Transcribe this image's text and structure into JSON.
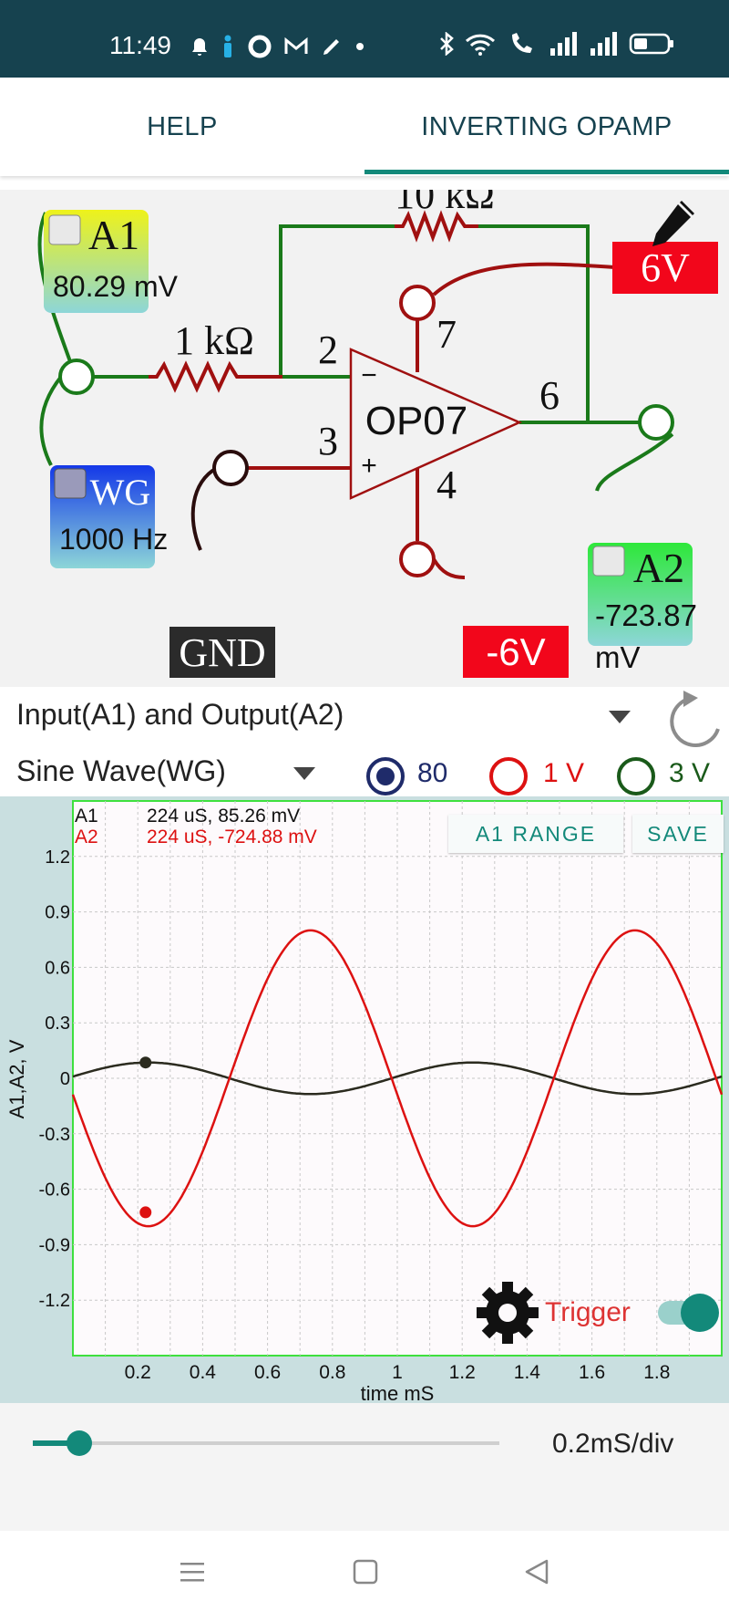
{
  "status": {
    "time": "11:49"
  },
  "tabs": [
    {
      "label": "HELP"
    },
    {
      "label": "INVERTING OPAMP"
    }
  ],
  "circuit": {
    "meter_a1": {
      "name": "A1",
      "value": "80.29 mV"
    },
    "meter_a2": {
      "name": "A2",
      "value_line1": "-723.87",
      "value_line2": "mV"
    },
    "wg": {
      "name": "WG",
      "value": "1000 Hz"
    },
    "feedback_resistor": "10 kΩ",
    "input_resistor": "1 kΩ",
    "opamp": "OP07",
    "pins": {
      "inv": "2",
      "noninv": "3",
      "out": "6",
      "vplus": "7",
      "vminus": "4"
    },
    "supply_pos": "6V",
    "supply_neg": "-6V",
    "gnd": "GND"
  },
  "controls": {
    "view_select": "Input(A1) and Output(A2)",
    "source_select": "Sine Wave(WG)",
    "ranges": [
      {
        "label": "80",
        "selected": true
      },
      {
        "label": "1 V",
        "selected": false
      },
      {
        "label": "3 V",
        "selected": false
      }
    ]
  },
  "plot": {
    "a1_label": "A1",
    "a1_readout": "224 uS, 85.26 mV",
    "a2_label": "A2",
    "a2_readout": "224 uS, -724.88 mV",
    "range_button": "A1 RANGE",
    "save_button": "SAVE",
    "trigger_label": "Trigger",
    "trigger_on": true,
    "ylabel": "A1,A2, V",
    "xlabel": "time mS",
    "y_ticks": [
      "1.2",
      "0.9",
      "0.6",
      "0.3",
      "0",
      "-0.3",
      "-0.6",
      "-0.9",
      "-1.2"
    ],
    "x_ticks": [
      "0.2",
      "0.4",
      "0.6",
      "0.8",
      "1",
      "1.2",
      "1.4",
      "1.6",
      "1.8"
    ]
  },
  "chart_data": {
    "type": "line",
    "xlabel": "time mS",
    "ylabel": "A1,A2, V",
    "xlim": [
      0,
      2.0
    ],
    "ylim": [
      -1.5,
      1.5
    ],
    "series": [
      {
        "name": "A1",
        "color": "#2b2b1f",
        "frequency_hz": 1000,
        "amplitude": 0.0853,
        "marker_x": 0.224,
        "marker_y": 0.0853
      },
      {
        "name": "A2",
        "color": "#dd1111",
        "frequency_hz": 1000,
        "amplitude": -0.8,
        "marker_x": 0.224,
        "marker_y": -0.7249
      }
    ]
  },
  "timebase": {
    "label": "0.2mS/div",
    "slider_value": 0.1
  }
}
